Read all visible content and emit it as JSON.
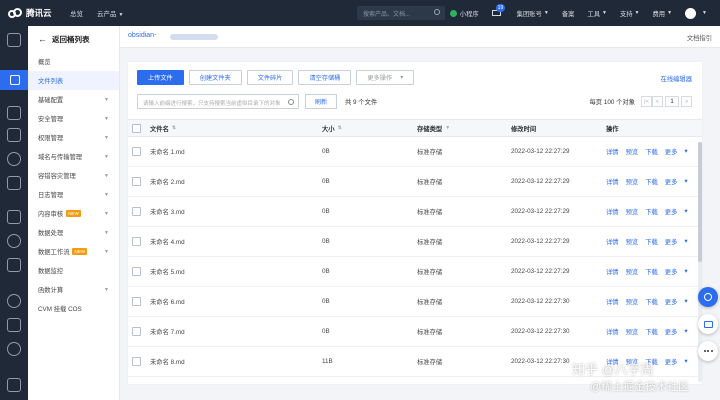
{
  "topbar": {
    "brand": "腾讯云",
    "nav": [
      "总览",
      "云产品"
    ],
    "search_placeholder": "搜索产品、文档...",
    "mini_program": "小程序",
    "message_count": "19",
    "items": [
      "集团账号",
      "备案",
      "工具",
      "支持",
      "费用"
    ]
  },
  "sidebar": {
    "back_label": "返回桶列表",
    "items": [
      {
        "label": "概览",
        "expandable": false,
        "active": false
      },
      {
        "label": "文件列表",
        "expandable": false,
        "active": true
      },
      {
        "label": "基础配置",
        "expandable": true,
        "active": false
      },
      {
        "label": "安全管理",
        "expandable": true,
        "active": false
      },
      {
        "label": "权限管理",
        "expandable": true,
        "active": false
      },
      {
        "label": "域名与传输管理",
        "expandable": true,
        "active": false
      },
      {
        "label": "容错容灾管理",
        "expandable": true,
        "active": false
      },
      {
        "label": "日志管理",
        "expandable": true,
        "active": false
      },
      {
        "label": "内容审核",
        "expandable": true,
        "active": false,
        "badge": "NEW"
      },
      {
        "label": "数据处理",
        "expandable": true,
        "active": false
      },
      {
        "label": "数据工作流",
        "expandable": true,
        "active": false,
        "badge": "NEW"
      },
      {
        "label": "数据监控",
        "expandable": false,
        "active": false
      },
      {
        "label": "函数计算",
        "expandable": true,
        "active": false
      },
      {
        "label": "CVM 挂载 COS",
        "expandable": false,
        "active": false
      }
    ]
  },
  "header": {
    "bucket_name": "obsidian-",
    "doc_guide": "文档指引"
  },
  "toolbar": {
    "upload": "上传文件",
    "create_folder": "创建文件夹",
    "file_fragments": "文件碎片",
    "clear_bucket": "清空存储桶",
    "more_actions": "更多操作",
    "online_editor": "在线编辑器"
  },
  "search": {
    "placeholder": "请输入前缀进行搜索，只支持搜索当前虚拟目录下的对象",
    "refresh": "刷新",
    "file_count": "共 9 个文件"
  },
  "pager": {
    "per_page": "每页 100 个对象",
    "first": "|<",
    "prev": "<",
    "page": "1",
    "next": ">"
  },
  "table": {
    "columns": [
      "文件名",
      "大小",
      "存储类型",
      "修改时间",
      "操作"
    ],
    "row_actions": [
      "详情",
      "预览",
      "下载",
      "更多"
    ],
    "rows": [
      {
        "name": "未命名 1.md",
        "size": "0B",
        "type": "标准存储",
        "time": "2022-03-12 22:27:29"
      },
      {
        "name": "未命名 2.md",
        "size": "0B",
        "type": "标准存储",
        "time": "2022-03-12 22:27:29"
      },
      {
        "name": "未命名 3.md",
        "size": "0B",
        "type": "标准存储",
        "time": "2022-03-12 22:27:29"
      },
      {
        "name": "未命名 4.md",
        "size": "0B",
        "type": "标准存储",
        "time": "2022-03-12 22:27:29"
      },
      {
        "name": "未命名 5.md",
        "size": "0B",
        "type": "标准存储",
        "time": "2022-03-12 22:27:29"
      },
      {
        "name": "未命名 6.md",
        "size": "0B",
        "type": "标准存储",
        "time": "2022-03-12 22:27:30"
      },
      {
        "name": "未命名 7.md",
        "size": "0B",
        "type": "标准存储",
        "time": "2022-03-12 22:27:30"
      },
      {
        "name": "未命名 8.md",
        "size": "11B",
        "type": "标准存储",
        "time": "2022-03-12 22:27:30"
      }
    ]
  },
  "watermark": {
    "line1": "知乎 @八字周",
    "line2": "@稀土掘金技术社区"
  },
  "colors": {
    "topbar_bg": "#1f2937",
    "accent": "#2c6df0",
    "page_bg": "#f2f4f7"
  }
}
